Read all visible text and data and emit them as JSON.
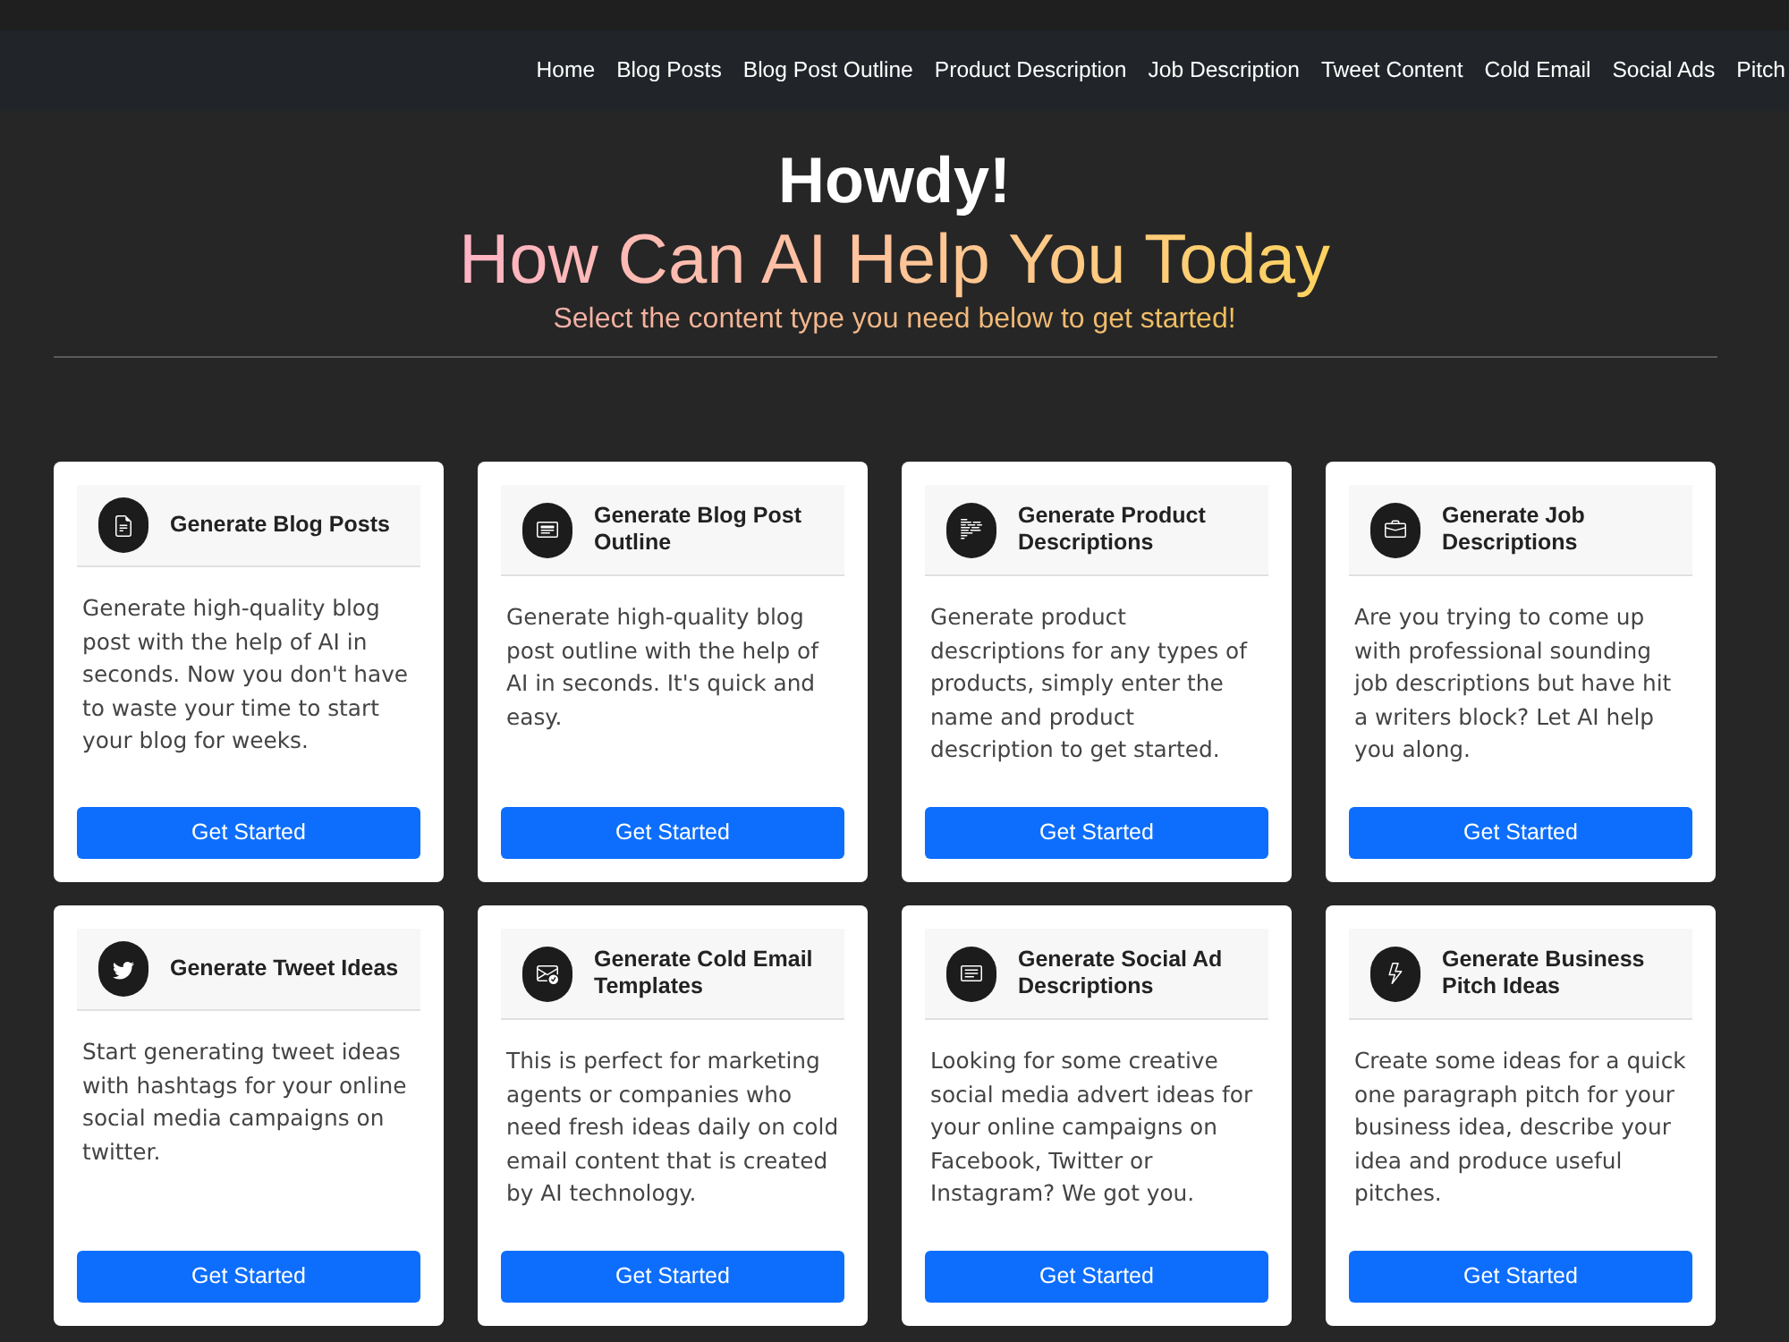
{
  "navbar": {
    "links": [
      "Home",
      "Blog Posts",
      "Blog Post Outline",
      "Product Description",
      "Job Description",
      "Tweet Content",
      "Cold Email",
      "Social Ads",
      "Pitch"
    ]
  },
  "hero": {
    "greeting": "Howdy!",
    "title": "How Can AI Help You Today",
    "subtitle": "Select the content type you need below to get started!"
  },
  "cards": [
    {
      "title": "Generate Blog Posts",
      "description": "Generate high-quality blog post with the help of AI in seconds. Now you don't have to waste your time to start your blog for weeks.",
      "button": "Get Started"
    },
    {
      "title": "Generate Blog Post Outline",
      "description": "Generate high-quality blog post outline with the help of AI in seconds. It's quick and easy.",
      "button": "Get Started"
    },
    {
      "title": "Generate Product Descriptions",
      "description": "Generate product descriptions for any types of products, simply enter the name and product description to get started.",
      "button": "Get Started"
    },
    {
      "title": "Generate Job Descriptions",
      "description": "Are you trying to come up with professional sounding job descriptions but have hit a writers block? Let AI help you along.",
      "button": "Get Started"
    },
    {
      "title": "Generate Tweet Ideas",
      "description": "Start generating tweet ideas with hashtags for your online social media campaigns on twitter.",
      "button": "Get Started"
    },
    {
      "title": "Generate Cold Email Templates",
      "description": "This is perfect for marketing agents or companies who need fresh ideas daily on cold email content that is created by AI technology.",
      "button": "Get Started"
    },
    {
      "title": "Generate Social Ad Descriptions",
      "description": "Looking for some creative social media advert ideas for your online campaigns on Facebook, Twitter or Instagram? We got you.",
      "button": "Get Started"
    },
    {
      "title": "Generate Business Pitch Ideas",
      "description": "Create some ideas for a quick one paragraph pitch for your business idea, describe your idea and produce useful pitches.",
      "button": "Get Started"
    }
  ]
}
